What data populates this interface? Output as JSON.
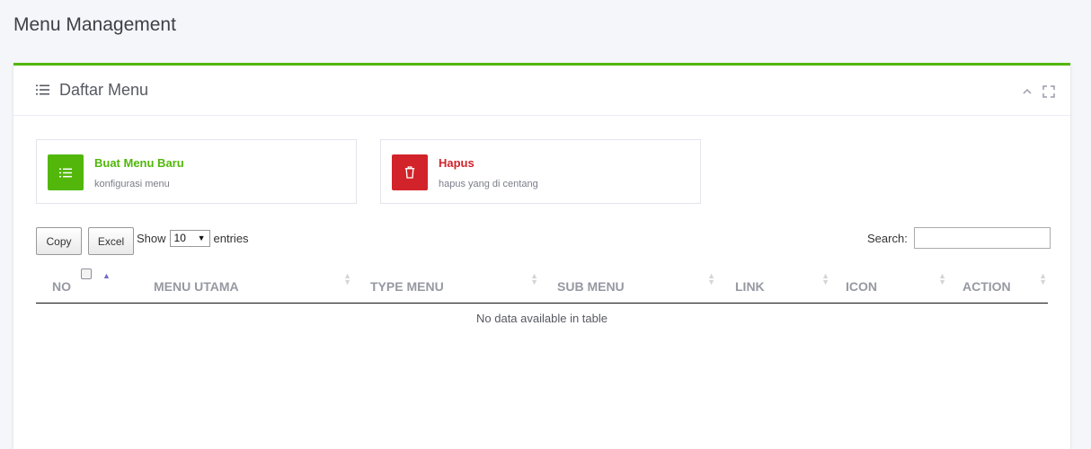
{
  "page": {
    "title": "Menu Management"
  },
  "portlet": {
    "title": "Daftar Menu"
  },
  "actions": [
    {
      "title": "Buat Menu Baru",
      "subtitle": "konfigurasi menu",
      "color": "#52b70a",
      "icon": "list-icon"
    },
    {
      "title": "Hapus",
      "subtitle": "hapus yang di centang",
      "color": "#d2232a",
      "icon": "trash-icon"
    }
  ],
  "table_controls": {
    "copy_label": "Copy",
    "excel_label": "Excel",
    "show_label": "Show",
    "page_length": "10",
    "entries_label": "entries",
    "search_label": "Search:",
    "search_value": ""
  },
  "table": {
    "columns": [
      "NO",
      "MENU UTAMA",
      "TYPE MENU",
      "SUB MENU",
      "LINK",
      "ICON",
      "ACTION"
    ],
    "empty_message": "No data available in table"
  },
  "colors": {
    "accent": "#52b70a",
    "danger": "#d2232a",
    "header_text": "#9699a2"
  }
}
